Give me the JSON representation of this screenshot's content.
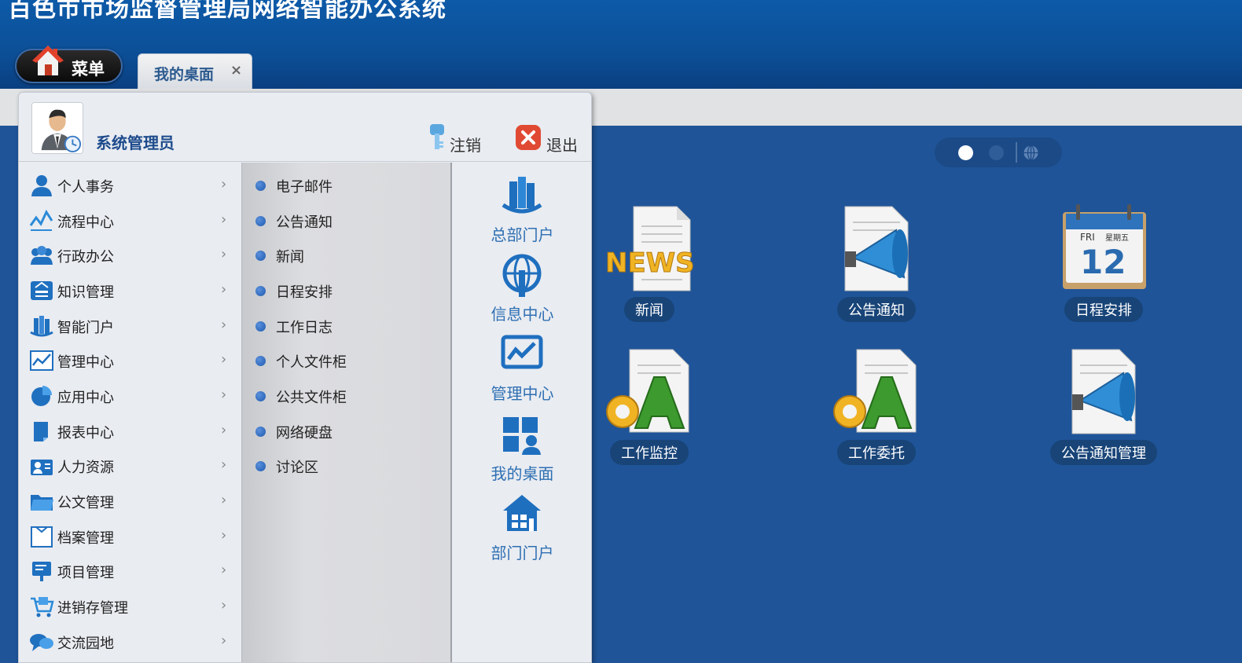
{
  "header": {
    "title": "百色市市场监督管理局网络智能办公系统",
    "menu_button": "菜单"
  },
  "tabs": [
    {
      "label": "我的桌面",
      "close": "×"
    }
  ],
  "start_menu": {
    "user": "系统管理员",
    "logout": "注销",
    "exit": "退出",
    "categories": [
      {
        "label": "个人事务",
        "icon": "person-icon"
      },
      {
        "label": "流程中心",
        "icon": "flow-icon"
      },
      {
        "label": "行政办公",
        "icon": "group-icon"
      },
      {
        "label": "知识管理",
        "icon": "knowledge-icon"
      },
      {
        "label": "智能门户",
        "icon": "building-icon"
      },
      {
        "label": "管理中心",
        "icon": "chart-icon"
      },
      {
        "label": "应用中心",
        "icon": "pie-icon"
      },
      {
        "label": "报表中心",
        "icon": "report-icon"
      },
      {
        "label": "人力资源",
        "icon": "hr-icon"
      },
      {
        "label": "公文管理",
        "icon": "folder-icon"
      },
      {
        "label": "档案管理",
        "icon": "archive-icon"
      },
      {
        "label": "项目管理",
        "icon": "project-icon"
      },
      {
        "label": "进销存管理",
        "icon": "cart-icon"
      },
      {
        "label": "交流园地",
        "icon": "chat-icon"
      }
    ],
    "chevron": "›",
    "submenu": [
      "电子邮件",
      "公告通知",
      "新闻",
      "日程安排",
      "工作日志",
      "个人文件柜",
      "公共文件柜",
      "网络硬盘",
      "讨论区"
    ],
    "portals": [
      {
        "label": "总部门户",
        "icon": "headquarters-icon"
      },
      {
        "label": "信息中心",
        "icon": "info-globe-icon"
      },
      {
        "label": "管理中心",
        "icon": "management-chart-icon"
      },
      {
        "label": "我的桌面",
        "icon": "desktop-grid-icon"
      },
      {
        "label": "部门门户",
        "icon": "department-house-icon"
      }
    ]
  },
  "desktop": {
    "apps": [
      {
        "label": "新闻",
        "icon": "news-icon"
      },
      {
        "label": "公告通知",
        "icon": "megaphone-icon"
      },
      {
        "label": "日程安排",
        "icon": "calendar-icon"
      },
      {
        "label": "工作监控",
        "icon": "oa-document-icon"
      },
      {
        "label": "工作委托",
        "icon": "oa-document-icon"
      },
      {
        "label": "公告通知管理",
        "icon": "megaphone-icon"
      }
    ],
    "calendar": {
      "day_en": "FRI",
      "day_cn": "星期五",
      "date": "12"
    },
    "news_text": "NEWS",
    "oa_text": "OA"
  },
  "colors": {
    "header_blue": "#0c4f97",
    "desktop_bg": "#1f5498",
    "link_blue": "#2e6fb3",
    "label_pill": "#184478"
  }
}
